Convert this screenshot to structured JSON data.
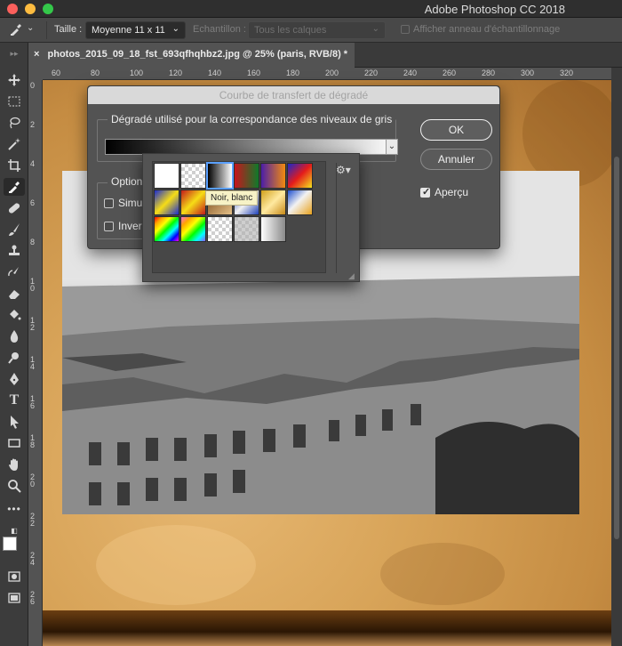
{
  "window": {
    "title": "Adobe Photoshop CC 2018"
  },
  "options_bar": {
    "size_label": "Taille :",
    "size_value": "Moyenne 11 x 11",
    "sample_label": "Echantillon :",
    "sample_value": "Tous les calques",
    "show_ring_label": "Afficher anneau d'échantillonnage"
  },
  "document": {
    "tab_title": "photos_2015_09_18_fst_693qfhqhbz2.jpg @ 25% (paris, RVB/8) *",
    "close_glyph": "×"
  },
  "rulers": {
    "top": [
      "60",
      "80",
      "100",
      "120",
      "140",
      "160",
      "180",
      "200",
      "220",
      "240",
      "260",
      "280",
      "300",
      "320"
    ],
    "left": [
      "0",
      "2",
      "4",
      "6",
      "8",
      "10",
      "12",
      "14",
      "16",
      "18",
      "20",
      "22",
      "24",
      "26"
    ]
  },
  "dialog": {
    "title": "Courbe de transfert de dégradé",
    "gradient_group_title": "Dégradé utilisé pour la correspondance des niveaux de gris",
    "options_group_title": "Option",
    "simulate_label": "Simul",
    "invert_label": "Invers",
    "ok_label": "OK",
    "cancel_label": "Annuler",
    "preview_label": "Aperçu",
    "preview_checked": true
  },
  "gradient_popup": {
    "tooltip": "Noir, blanc",
    "selected_index": 2
  },
  "icons": {
    "dropdown_caret": "⌄",
    "gear": "⚙▾",
    "grip": "◢"
  }
}
